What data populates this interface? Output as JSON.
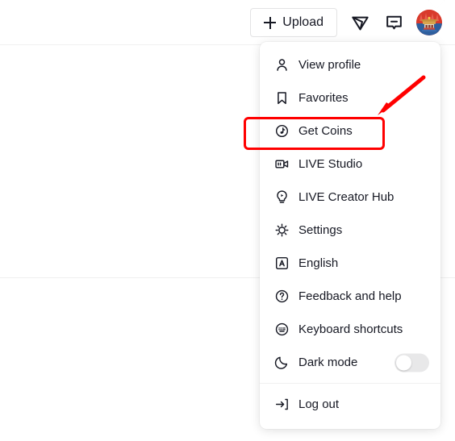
{
  "header": {
    "upload_button": {
      "label": "Upload",
      "icon": "plus-icon"
    },
    "inbox_icon": "send-inbox-icon",
    "messages_icon": "message-bubble-icon",
    "avatar_icon": "user-avatar"
  },
  "profile_menu": {
    "items": [
      {
        "label": "View profile",
        "icon": "person-icon"
      },
      {
        "label": "Favorites",
        "icon": "bookmark-icon"
      },
      {
        "label": "Get Coins",
        "icon": "coin-music-note-icon"
      },
      {
        "label": "LIVE Studio",
        "icon": "video-camera-icon"
      },
      {
        "label": "LIVE Creator Hub",
        "icon": "lightbulb-play-icon"
      },
      {
        "label": "Settings",
        "icon": "gear-icon"
      },
      {
        "label": "English",
        "icon": "language-a-icon"
      },
      {
        "label": "Feedback and help",
        "icon": "question-circle-icon"
      },
      {
        "label": "Keyboard shortcuts",
        "icon": "keyboard-icon"
      },
      {
        "label": "Dark mode",
        "icon": "moon-icon",
        "toggle": "off"
      },
      {
        "label": "Log out",
        "icon": "logout-arrow-icon"
      }
    ]
  },
  "annotation": {
    "highlight_target": "Get Coins",
    "highlight_color": "#ff0000",
    "arrow_color": "#ff0000"
  }
}
